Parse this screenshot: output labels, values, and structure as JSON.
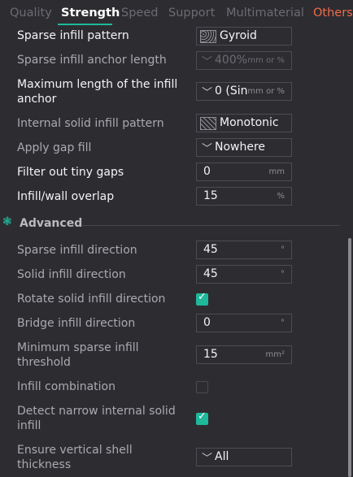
{
  "tabs": [
    "Quality",
    "Strength",
    "Speed",
    "Support",
    "Multimaterial",
    "Others"
  ],
  "colors": {
    "accent": "#1fb89a",
    "others_tab": "#f36b4a"
  },
  "rows": {
    "sparse_pattern": {
      "label": "Sparse infill pattern",
      "value": "Gyroid"
    },
    "anchor_length": {
      "label": "Sparse infill anchor length",
      "value": "400%",
      "unit": "mm or %"
    },
    "max_anchor": {
      "label": "Maximum length of the infill anchor",
      "value": "0 (Sin",
      "unit": "mm or %"
    },
    "internal_solid": {
      "label": "Internal solid infill pattern",
      "value": "Monotonic"
    },
    "gap_fill": {
      "label": "Apply gap fill",
      "value": "Nowhere"
    },
    "tiny_gaps": {
      "label": "Filter out tiny gaps",
      "value": "0",
      "unit": "mm"
    },
    "overlap": {
      "label": "Infill/wall overlap",
      "value": "15",
      "unit": "%"
    },
    "advanced_title": "Advanced",
    "sparse_dir": {
      "label": "Sparse infill direction",
      "value": "45",
      "unit": "°"
    },
    "solid_dir": {
      "label": "Solid infill direction",
      "value": "45",
      "unit": "°"
    },
    "rotate_solid": {
      "label": "Rotate solid infill direction",
      "checked": true
    },
    "bridge_dir": {
      "label": "Bridge infill direction",
      "value": "0",
      "unit": "°"
    },
    "min_sparse": {
      "label": "Minimum sparse infill threshold",
      "value": "15",
      "unit": "mm²"
    },
    "combination": {
      "label": "Infill combination",
      "checked": false
    },
    "narrow": {
      "label": "Detect narrow internal solid infill",
      "checked": true
    },
    "vertical_shell": {
      "label": "Ensure vertical shell thickness",
      "value": "All"
    }
  }
}
